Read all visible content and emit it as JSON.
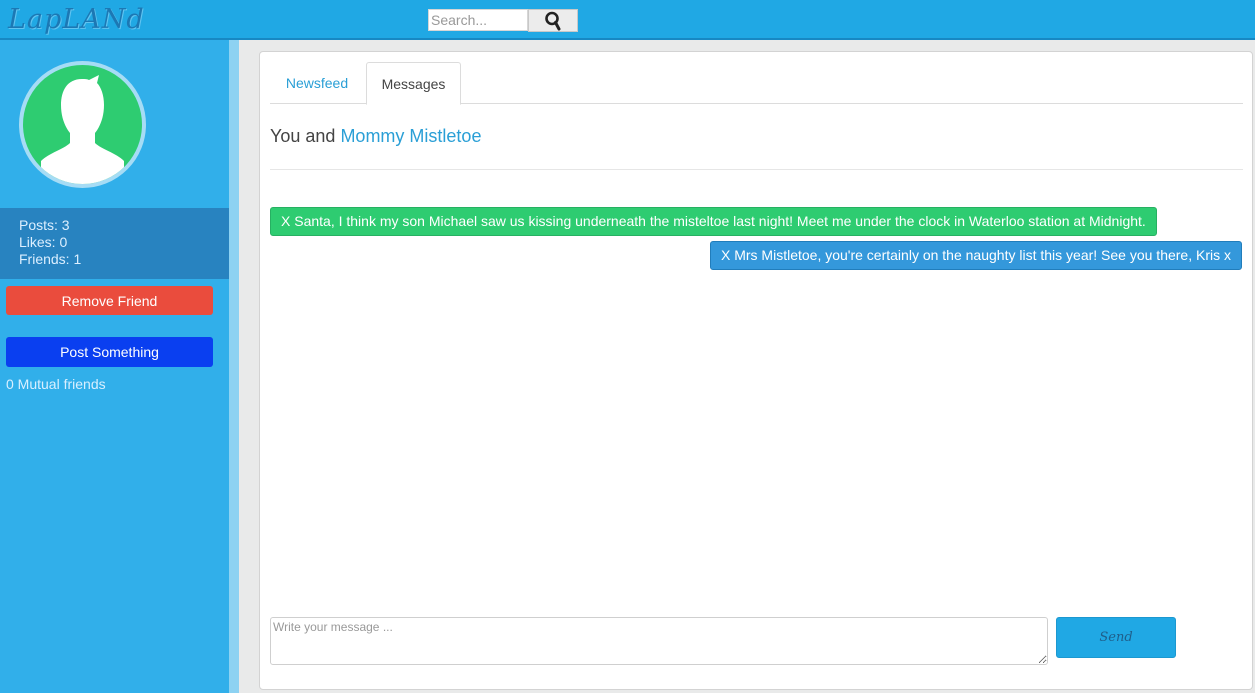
{
  "app": {
    "logo": "LapLANd"
  },
  "search": {
    "placeholder": "Search...",
    "value": ""
  },
  "sidebar": {
    "stats": {
      "posts": "Posts: 3",
      "likes": "Likes: 0",
      "friends": "Friends: 1"
    },
    "remove_friend_label": "Remove Friend",
    "post_label": "Post Something",
    "mutual_friends": "0 Mutual friends"
  },
  "tabs": [
    {
      "label": "Newsfeed",
      "active": false
    },
    {
      "label": "Messages",
      "active": true
    }
  ],
  "conversation": {
    "title_prefix": "You and",
    "contact_name": "Mommy Mistletoe",
    "messages": [
      {
        "direction": "received",
        "text": "X Santa, I think my son Michael saw us kissing underneath the misteltoe last night! Meet me under the clock in Waterloo station at Midnight."
      },
      {
        "direction": "sent",
        "text": "X Mrs Mistletoe, you're certainly on the naughty list this year! See you there, Kris x"
      }
    ],
    "input_placeholder": "Write your message ...",
    "input_value": "",
    "send_label": "Send"
  },
  "colors": {
    "topbar": "#20a8e4",
    "sidebar": "#31afea",
    "avatar_bg": "#2ecc71",
    "remove_button": "#ea4c3d",
    "post_button": "#0a3ff0",
    "received_bubble": "#2ecc71",
    "sent_bubble": "#3498db",
    "link": "#2a9fd6"
  },
  "icons": {
    "search": "search-icon",
    "avatar": "user-silhouette-icon",
    "resize": "resize-handle-icon"
  }
}
